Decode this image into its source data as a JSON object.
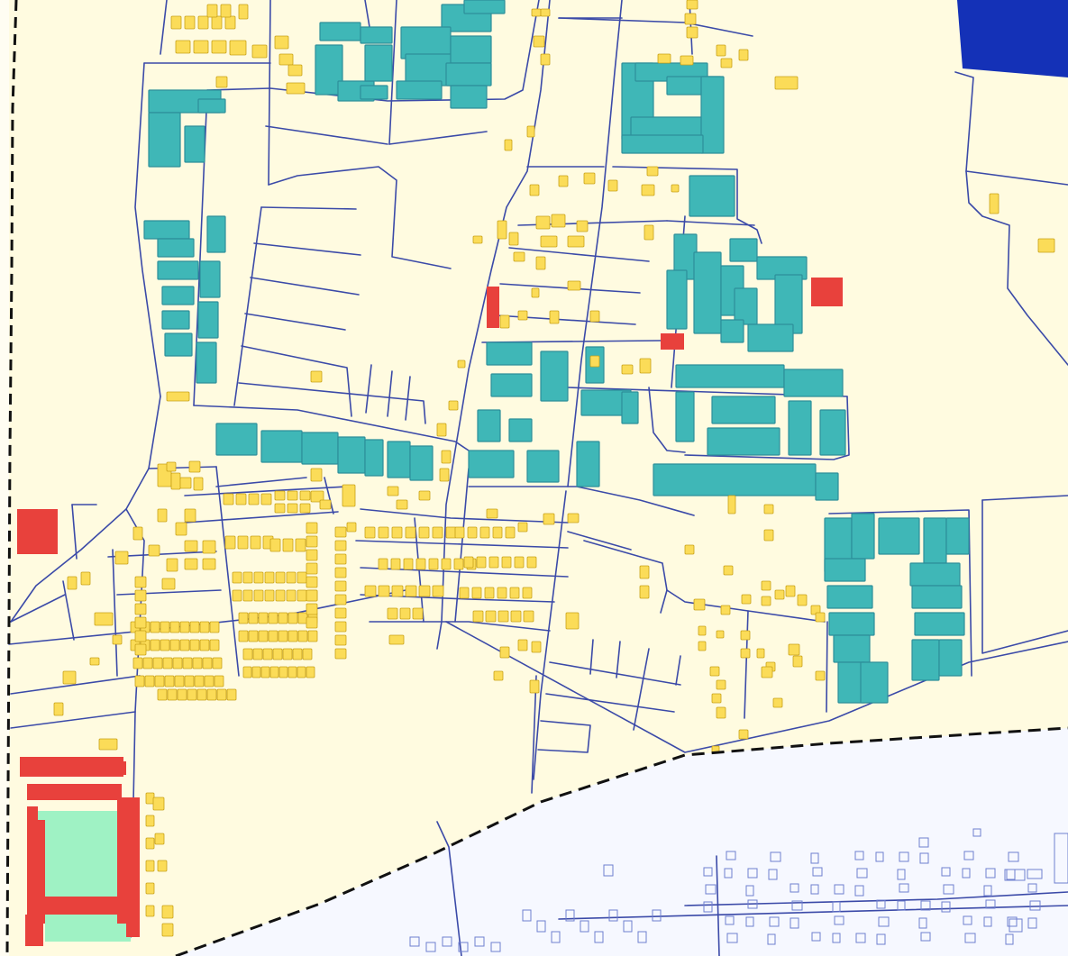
{
  "map": {
    "colors": {
      "land": "#fffbe0",
      "outside": "#f6f8ff",
      "road": "#3b4aa8",
      "residential": "#fbdc58",
      "residential_edge": "#c9a21a",
      "apartment": "#3fb7b7",
      "apartment_edge": "#2d8f9a",
      "public": "#e8413c",
      "sports_field": "#9ff2c4",
      "water": "#1431b7",
      "boundary": "#111111",
      "outline_building": "#6f7fcf"
    },
    "layers": [
      "roads",
      "apartment-blocks",
      "houses",
      "public-buildings",
      "sports-field",
      "water",
      "district-boundary"
    ]
  }
}
